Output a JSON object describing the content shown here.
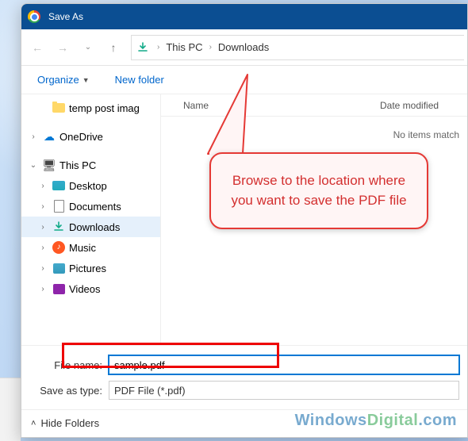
{
  "title": "Save As",
  "breadcrumb": {
    "root": "This PC",
    "current": "Downloads"
  },
  "toolbar": {
    "organize": "Organize",
    "new_folder": "New folder"
  },
  "sidebar": {
    "items": [
      {
        "label": "temp post imag",
        "icon": "folder"
      },
      {
        "label": "OneDrive",
        "icon": "cloud",
        "expander": "›"
      },
      {
        "label": "This PC",
        "icon": "pc",
        "expander": "⌄"
      },
      {
        "label": "Desktop",
        "icon": "desktop",
        "expander": "›",
        "child": true
      },
      {
        "label": "Documents",
        "icon": "docs",
        "expander": "›",
        "child": true
      },
      {
        "label": "Downloads",
        "icon": "down",
        "expander": "›",
        "child": true,
        "selected": true
      },
      {
        "label": "Music",
        "icon": "music",
        "expander": "›",
        "child": true
      },
      {
        "label": "Pictures",
        "icon": "pics",
        "expander": "›",
        "child": true
      },
      {
        "label": "Videos",
        "icon": "video",
        "expander": "›",
        "child": true
      }
    ]
  },
  "columns": {
    "name": "Name",
    "date": "Date modified"
  },
  "empty": "No items match",
  "filename_label": "File name:",
  "filename_value": "sample.pdf",
  "type_label": "Save as type:",
  "type_value": "PDF File (*.pdf)",
  "hide_folders": "Hide Folders",
  "callout": "Browse to the location where you want to save the PDF file",
  "watermark": {
    "a": "Windows",
    "b": "Digital",
    "c": ".com"
  }
}
